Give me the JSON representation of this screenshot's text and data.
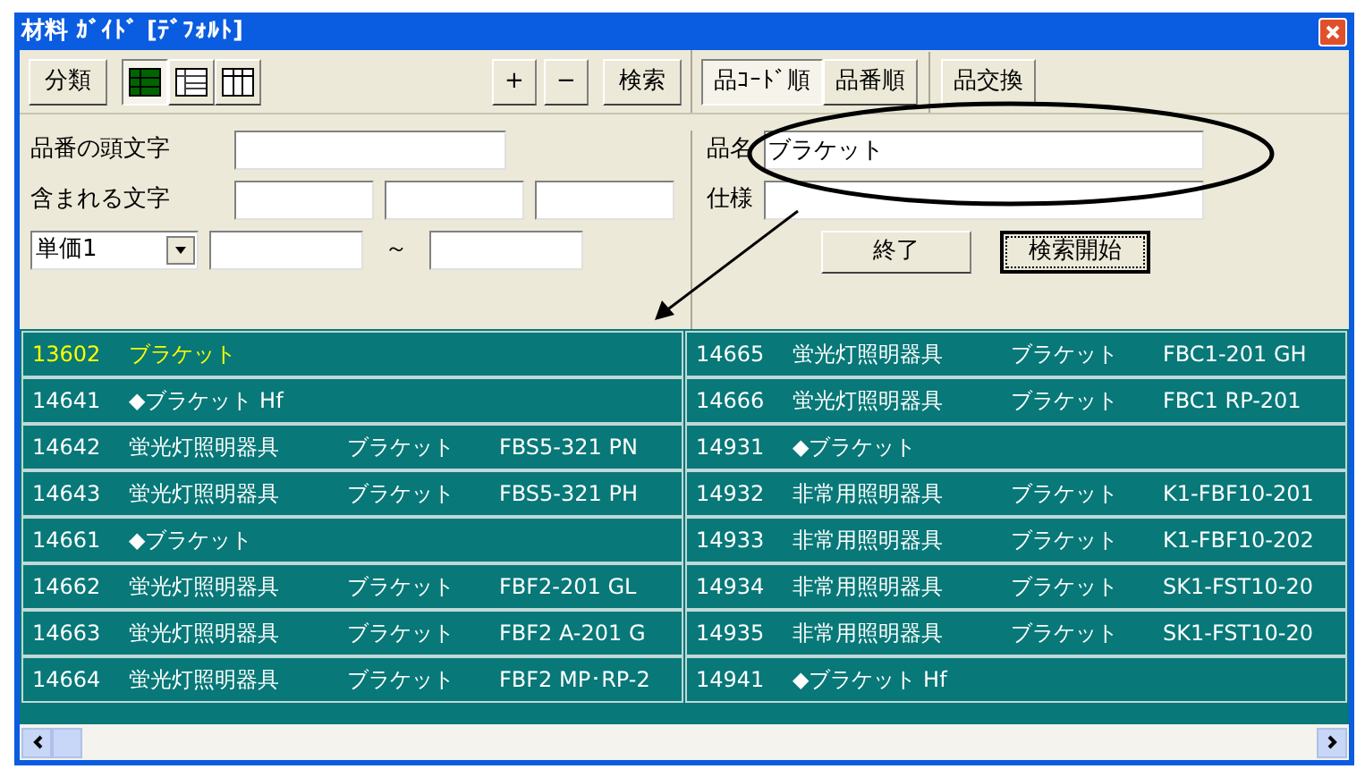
{
  "window": {
    "title": "材料 ｶﾞｲﾄﾞ [ﾃﾞﾌｫﾙﾄ]"
  },
  "toolbar": {
    "classify_button": "分類",
    "view_buttons": [
      {
        "kind": "filled",
        "selected": true
      },
      {
        "kind": "list",
        "selected": false
      },
      {
        "kind": "columns",
        "selected": false
      }
    ],
    "plus_button": "+",
    "minus_button": "−",
    "search_button": "検索",
    "sort_buttons": [
      {
        "label": "品ｺｰﾄﾞ順",
        "selected": true
      },
      {
        "label": "品番順",
        "selected": false
      }
    ],
    "swap_button": "品交換"
  },
  "form": {
    "prefix_label": "品番の頭文字",
    "contains_label": "含まれる文字",
    "price_select": "単価1",
    "range_separator": "～",
    "name_label": "品名",
    "name_value": "ブラケット",
    "spec_label": "仕様",
    "exit_button": "終了",
    "start_button": "検索開始"
  },
  "results": {
    "columns": [
      [
        {
          "code": "13602",
          "parts": [
            "ブラケット"
          ],
          "selected": true
        },
        {
          "code": "14641",
          "parts": [
            "◆ブラケット  Hf"
          ],
          "selected": false
        },
        {
          "code": "14642",
          "parts": [
            "蛍光灯照明器具",
            "ブラケット",
            "FBS5-321 PN"
          ],
          "selected": false
        },
        {
          "code": "14643",
          "parts": [
            "蛍光灯照明器具",
            "ブラケット",
            "FBS5-321 PH"
          ],
          "selected": false
        },
        {
          "code": "14661",
          "parts": [
            "◆ブラケット"
          ],
          "selected": false
        },
        {
          "code": "14662",
          "parts": [
            "蛍光灯照明器具",
            "ブラケット",
            "FBF2-201 GL"
          ],
          "selected": false
        },
        {
          "code": "14663",
          "parts": [
            "蛍光灯照明器具",
            "ブラケット",
            "FBF2 A-201 G"
          ],
          "selected": false
        },
        {
          "code": "14664",
          "parts": [
            "蛍光灯照明器具",
            "ブラケット",
            "FBF2 MP･RP-2"
          ],
          "selected": false
        }
      ],
      [
        {
          "code": "14665",
          "parts": [
            "蛍光灯照明器具",
            "ブラケット",
            "FBC1-201 GH"
          ],
          "selected": false
        },
        {
          "code": "14666",
          "parts": [
            "蛍光灯照明器具",
            "ブラケット",
            "FBC1 RP-201"
          ],
          "selected": false
        },
        {
          "code": "14931",
          "parts": [
            "◆ブラケット"
          ],
          "selected": false
        },
        {
          "code": "14932",
          "parts": [
            "非常用照明器具",
            "ブラケット",
            "K1-FBF10-201"
          ],
          "selected": false
        },
        {
          "code": "14933",
          "parts": [
            "非常用照明器具",
            "ブラケット",
            "K1-FBF10-202"
          ],
          "selected": false
        },
        {
          "code": "14934",
          "parts": [
            "非常用照明器具",
            "ブラケット",
            "SK1-FST10-20"
          ],
          "selected": false
        },
        {
          "code": "14935",
          "parts": [
            "非常用照明器具",
            "ブラケット",
            "SK1-FST10-20"
          ],
          "selected": false
        },
        {
          "code": "14941",
          "parts": [
            "◆ブラケット  Hf"
          ],
          "selected": false
        }
      ]
    ]
  }
}
